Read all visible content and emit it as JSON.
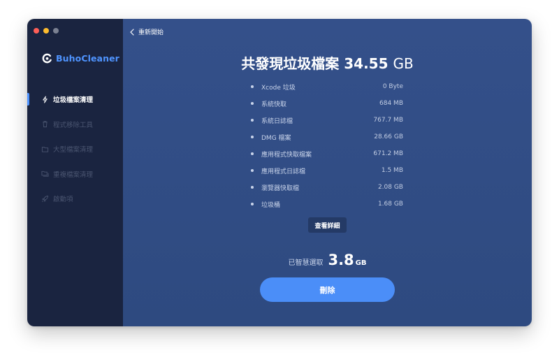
{
  "app": {
    "name": "BuhoCleaner"
  },
  "colors": {
    "accent": "#4f94ff",
    "sidebar_bg": "#1a2440",
    "main_bg": "#34508a",
    "delete_button": "#4b8ef8"
  },
  "sidebar": {
    "items": [
      {
        "label": "垃圾檔案清理",
        "icon": "lightning-icon",
        "active": true
      },
      {
        "label": "程式移除工具",
        "icon": "trash-icon",
        "active": false
      },
      {
        "label": "大型檔案清理",
        "icon": "folder-icon",
        "active": false
      },
      {
        "label": "重複檔案清理",
        "icon": "duplicate-folder-icon",
        "active": false
      },
      {
        "label": "啟動項",
        "icon": "rocket-icon",
        "active": false
      }
    ]
  },
  "header": {
    "back_label": "重新開始"
  },
  "summary": {
    "title_prefix": "共發現垃圾檔案",
    "total_value": "34.55",
    "total_unit": "GB"
  },
  "items": [
    {
      "name": "Xcode 垃圾",
      "size": "0 Byte"
    },
    {
      "name": "系統快取",
      "size": "684 MB"
    },
    {
      "name": "系統日誌檔",
      "size": "767.7 MB"
    },
    {
      "name": "DMG 檔案",
      "size": "28.66 GB"
    },
    {
      "name": "應用程式快取檔案",
      "size": "671.2 MB"
    },
    {
      "name": "應用程式日誌檔",
      "size": "1.5 MB"
    },
    {
      "name": "瀏覽器快取檔",
      "size": "2.08 GB"
    },
    {
      "name": "垃圾桶",
      "size": "1.68 GB"
    }
  ],
  "details_button": "查看詳細",
  "selection": {
    "label": "已智慧選取",
    "value": "3.8",
    "unit": "GB"
  },
  "delete_button": "刪除"
}
